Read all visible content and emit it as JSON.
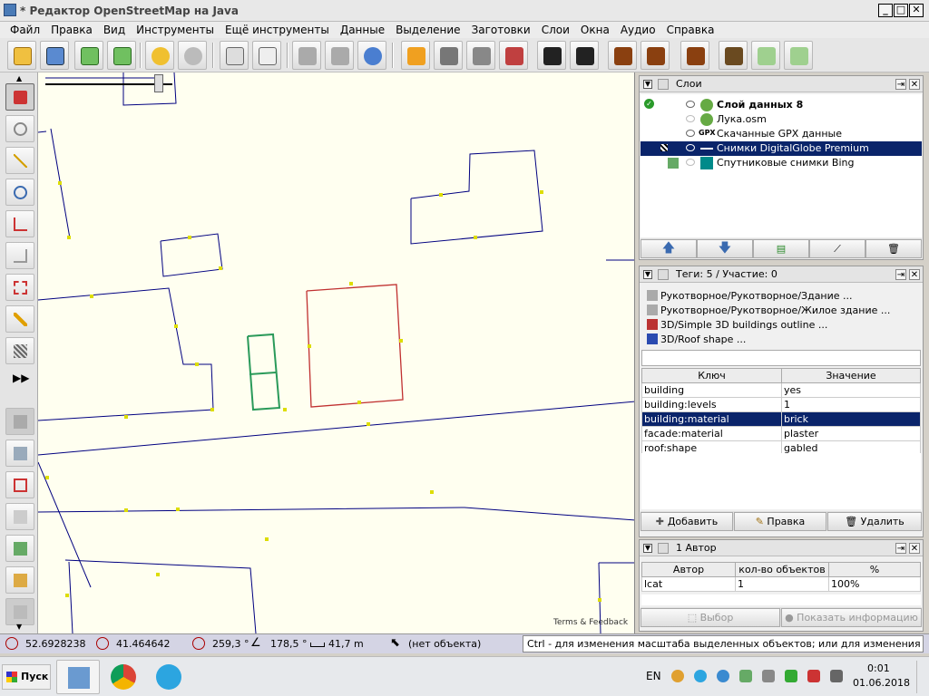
{
  "window": {
    "title": "* Редактор OpenStreetMap на Java",
    "controls": {
      "minimize": "_",
      "maximize": "□",
      "close": "✕"
    }
  },
  "menu": [
    "Файл",
    "Правка",
    "Вид",
    "Инструменты",
    "Ещё инструменты",
    "Данные",
    "Выделение",
    "Заготовки",
    "Слои",
    "Окна",
    "Аудио",
    "Справка"
  ],
  "toolbar_icons": [
    "open-file-icon",
    "save-icon",
    "download-icon",
    "upload-icon",
    "undo-icon",
    "redo-icon",
    "preferences-icon",
    "tag-inspector-icon",
    "simplify-way-icon",
    "merge-nodes-icon",
    "update-data-icon",
    "road-preset-icon",
    "railway-preset-icon",
    "barrier-preset-icon",
    "wall-preset-icon",
    "car-preset-icon",
    "bus-preset-icon",
    "info-preset-icon",
    "restaurant-preset-icon",
    "castle-preset-icon",
    "industrial-preset-icon",
    "osmose-icon",
    "revert-icon"
  ],
  "left_tools": [
    "select-tool-icon",
    "lasso-tool-icon",
    "draw-tool-icon",
    "zoom-tool-icon",
    "improve-way-tool-icon",
    "parallel-tool-icon",
    "extrude-tool-icon",
    "edit-icon",
    "building-tool-icon",
    "more-tools-icon",
    "layers-toggle-icon",
    "tags-toggle-icon",
    "relations-toggle-icon",
    "selection-list-icon",
    "validator-icon",
    "authors-icon",
    "history-icon"
  ],
  "status": {
    "lat": "52.6928238",
    "lon": "41.464642",
    "heading": "259,3 °",
    "angle": "178,5 °",
    "distance": "41,7 m",
    "selection": "(нет объекта)",
    "hint": "Ctrl - для изменения масштаба выделенных объектов; или для изменения выделения"
  },
  "map": {
    "attribution": "Terms & Feedback"
  },
  "layers_panel": {
    "title": "Слои",
    "layers": [
      {
        "name": "Слой данных 8",
        "active": true,
        "visible": true
      },
      {
        "name": "Лука.osm",
        "active": false,
        "visible": false
      },
      {
        "name": "Скачанные GPX данные",
        "active": false,
        "visible": true,
        "prefix": "GPX"
      },
      {
        "name": "Снимки DigitalGlobe Premium",
        "active": false,
        "visible": true,
        "selected": true
      },
      {
        "name": "Спутниковые снимки Bing",
        "active": false,
        "visible": false
      }
    ]
  },
  "tags_panel": {
    "title": "Теги: 5 / Участие: 0",
    "presets": [
      "Рукотворное/Рукотворное/Здание ...",
      "Рукотворное/Рукотворное/Жилое здание ...",
      "3D/Simple 3D buildings outline ...",
      "3D/Roof shape ..."
    ],
    "columns": [
      "Ключ",
      "Значение"
    ],
    "rows": [
      {
        "key": "building",
        "value": "yes"
      },
      {
        "key": "building:levels",
        "value": "1"
      },
      {
        "key": "building:material",
        "value": "brick",
        "selected": true
      },
      {
        "key": "facade:material",
        "value": "plaster"
      },
      {
        "key": "roof:shape",
        "value": "gabled"
      }
    ],
    "buttons": {
      "add": "Добавить",
      "edit": "Правка",
      "delete": "Удалить"
    }
  },
  "authors_panel": {
    "title": "1 Автор",
    "columns": [
      "Автор",
      "кол-во объектов",
      "%"
    ],
    "rows": [
      {
        "author": "lcat",
        "count": "1",
        "percent": "100%"
      }
    ],
    "buttons": {
      "select": "Выбор",
      "info": "Показать информацию"
    }
  },
  "taskbar": {
    "start": "Пуск",
    "lang": "EN",
    "time": "0:01",
    "date": "01.06.2018"
  }
}
